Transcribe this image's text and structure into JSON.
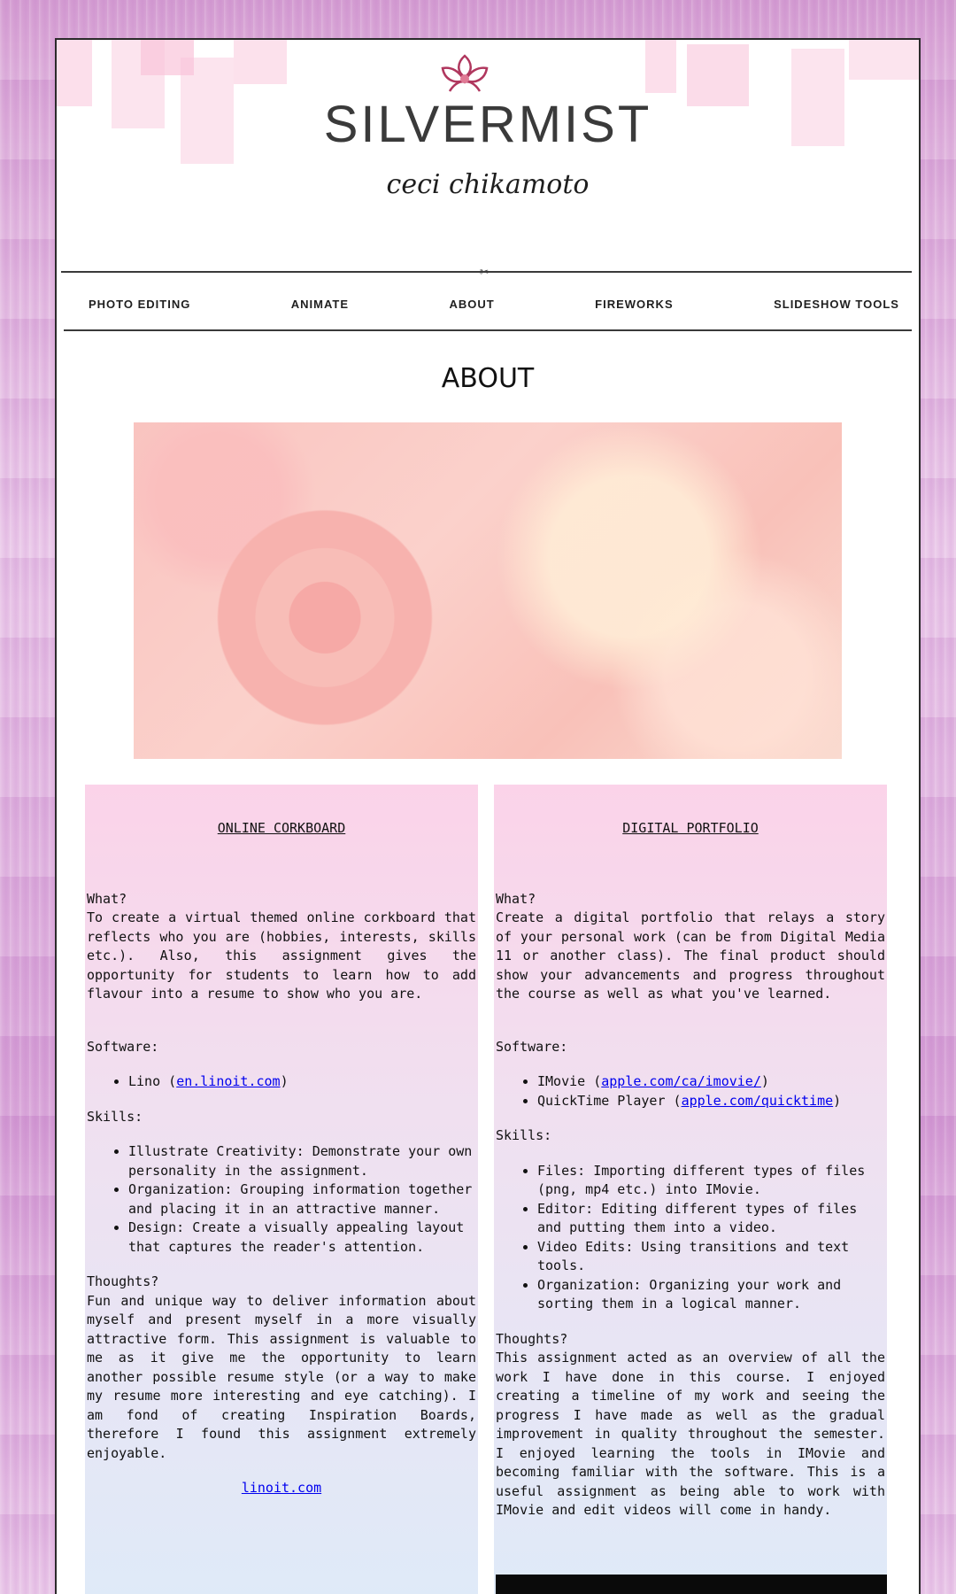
{
  "header": {
    "brand": "SILVERMIST",
    "signature": "ceci chikamoto",
    "accent": "#f9c4da",
    "logo_color": "#b0375e"
  },
  "nav": {
    "items": [
      "PHOTO EDITING",
      "ANIMATE",
      "ABOUT",
      "FIREWORKS",
      "SLIDESHOW TOOLS"
    ]
  },
  "page_title": "ABOUT",
  "left": {
    "title": "ONLINE CORKBOARD",
    "what_label": "What?",
    "what_text": "To create a virtual themed online corkboard that reflects who you are (hobbies, interests, skills etc.). Also, this assignment gives the opportunity for students to learn how to add flavour into a resume to show who you are.",
    "software_label": "Software:",
    "software": [
      {
        "name": "Lino (",
        "link": "en.linoit.com",
        "suffix": ")"
      }
    ],
    "skills_label": "Skills:",
    "skills": [
      "Illustrate Creativity: Demonstrate your own personality in the assignment.",
      "Organization: Grouping information together and placing it in an attractive manner.",
      "Design: Create a visually appealing layout that captures the reader's attention."
    ],
    "thoughts_label": "Thoughts?",
    "thoughts_text": "Fun and unique way to deliver information about myself and present myself in a more visually attractive form. This assignment is valuable to me as it give me the opportunity to learn another possible resume style (or a way to make my resume more interesting and eye catching). I am fond of creating Inspiration Boards, therefore I found this assignment extremely enjoyable.",
    "footer_link": "linoit.com"
  },
  "right": {
    "title": "DIGITAL PORTFOLIO",
    "what_label": "What?",
    "what_text": "Create a digital portfolio that relays a story of your personal work (can be from Digital Media 11 or another class). The final product should show your advancements and progress throughout the course as well as what you've learned.",
    "software_label": "Software:",
    "software": [
      {
        "name": "IMovie (",
        "link": "apple.com/ca/imovie/",
        "suffix": ")"
      },
      {
        "name": "QuickTime Player (",
        "link": "apple.com/quicktime",
        "suffix": ")"
      }
    ],
    "skills_label": "Skills:",
    "skills": [
      "Files: Importing different types of files (png, mp4 etc.) into IMovie.",
      "Editor: Editing different types of files and putting them into a video.",
      "Video Edits: Using transitions and text tools.",
      "Organization: Organizing your work and sorting them in a logical manner."
    ],
    "thoughts_label": "Thoughts?",
    "thoughts_text": "This assignment acted as an overview of all the work I have done in this course. I enjoyed creating a timeline of my work and seeing the progress I have made as well as the gradual improvement in quality throughout the semester. I enjoyed learning the tools in IMovie and becoming familiar with the software. This is a useful assignment as being able to work with IMovie and edit videos will come in handy."
  }
}
